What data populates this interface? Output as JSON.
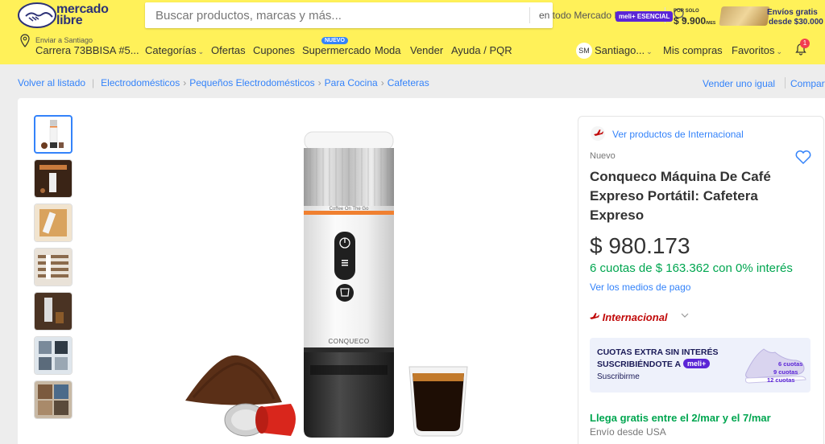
{
  "header": {
    "logo_line1": "mercado",
    "logo_line2": "libre",
    "search_placeholder": "Buscar productos, marcas y más...",
    "search_scope": "en todo Mercado Libre",
    "promo": {
      "badge": "meli+ ESENCIAL",
      "small": "POR SOLO",
      "price": "$ 9.900",
      "price_unit": "/MES",
      "ship1": "Envíos gratis",
      "ship2": "desde $30.000"
    },
    "location_label": "Enviar a Santiago",
    "location_address": "Carrera 73BBISA #5...",
    "nav": [
      "Categorías",
      "Ofertas",
      "Cupones",
      "Supermercado",
      "Moda",
      "Vender",
      "Ayuda / PQR"
    ],
    "nuevo_badge": "NUEVO",
    "avatar_initials": "SM",
    "user_name": "Santiago...",
    "mis_compras": "Mis compras",
    "favoritos": "Favoritos",
    "notif_count": "1"
  },
  "breadcrumb": {
    "back": "Volver al listado",
    "items": [
      "Electrodomésticos",
      "Pequeños Electrodomésticos",
      "Para Cocina",
      "Cafeteras"
    ],
    "sell_same": "Vender uno igual",
    "compare": "Compartir"
  },
  "product": {
    "intl_link": "Ver productos de Internacional",
    "condition": "Nuevo",
    "title": "Conqueco Máquina De Café Expreso Portátil: Cafetera Expreso",
    "price": "$ 980.173",
    "cuotas": "6 cuotas de $ 163.362 con 0% interés",
    "medios": "Ver los medios de pago",
    "intl_tag": "Internacional",
    "machine_top_text": "Coffee On The Go",
    "machine_brand": "CONQUECO",
    "banner": {
      "line1": "CUOTAS EXTRA SIN INTERÉS",
      "line2": "SUSCRIBIÉNDOTE A",
      "pill": "meli+",
      "sub": "Suscribirme",
      "q1": "6 cuotas",
      "q2": "9 cuotas",
      "q3": "12 cuotas"
    },
    "shipping": "Llega gratis entre el 2/mar y el 7/mar",
    "ship_from": "Envío desde USA"
  },
  "colors": {
    "header_bg": "#fff159",
    "link": "#3483fa",
    "green": "#00a650",
    "intl_red": "#c10a0a"
  }
}
